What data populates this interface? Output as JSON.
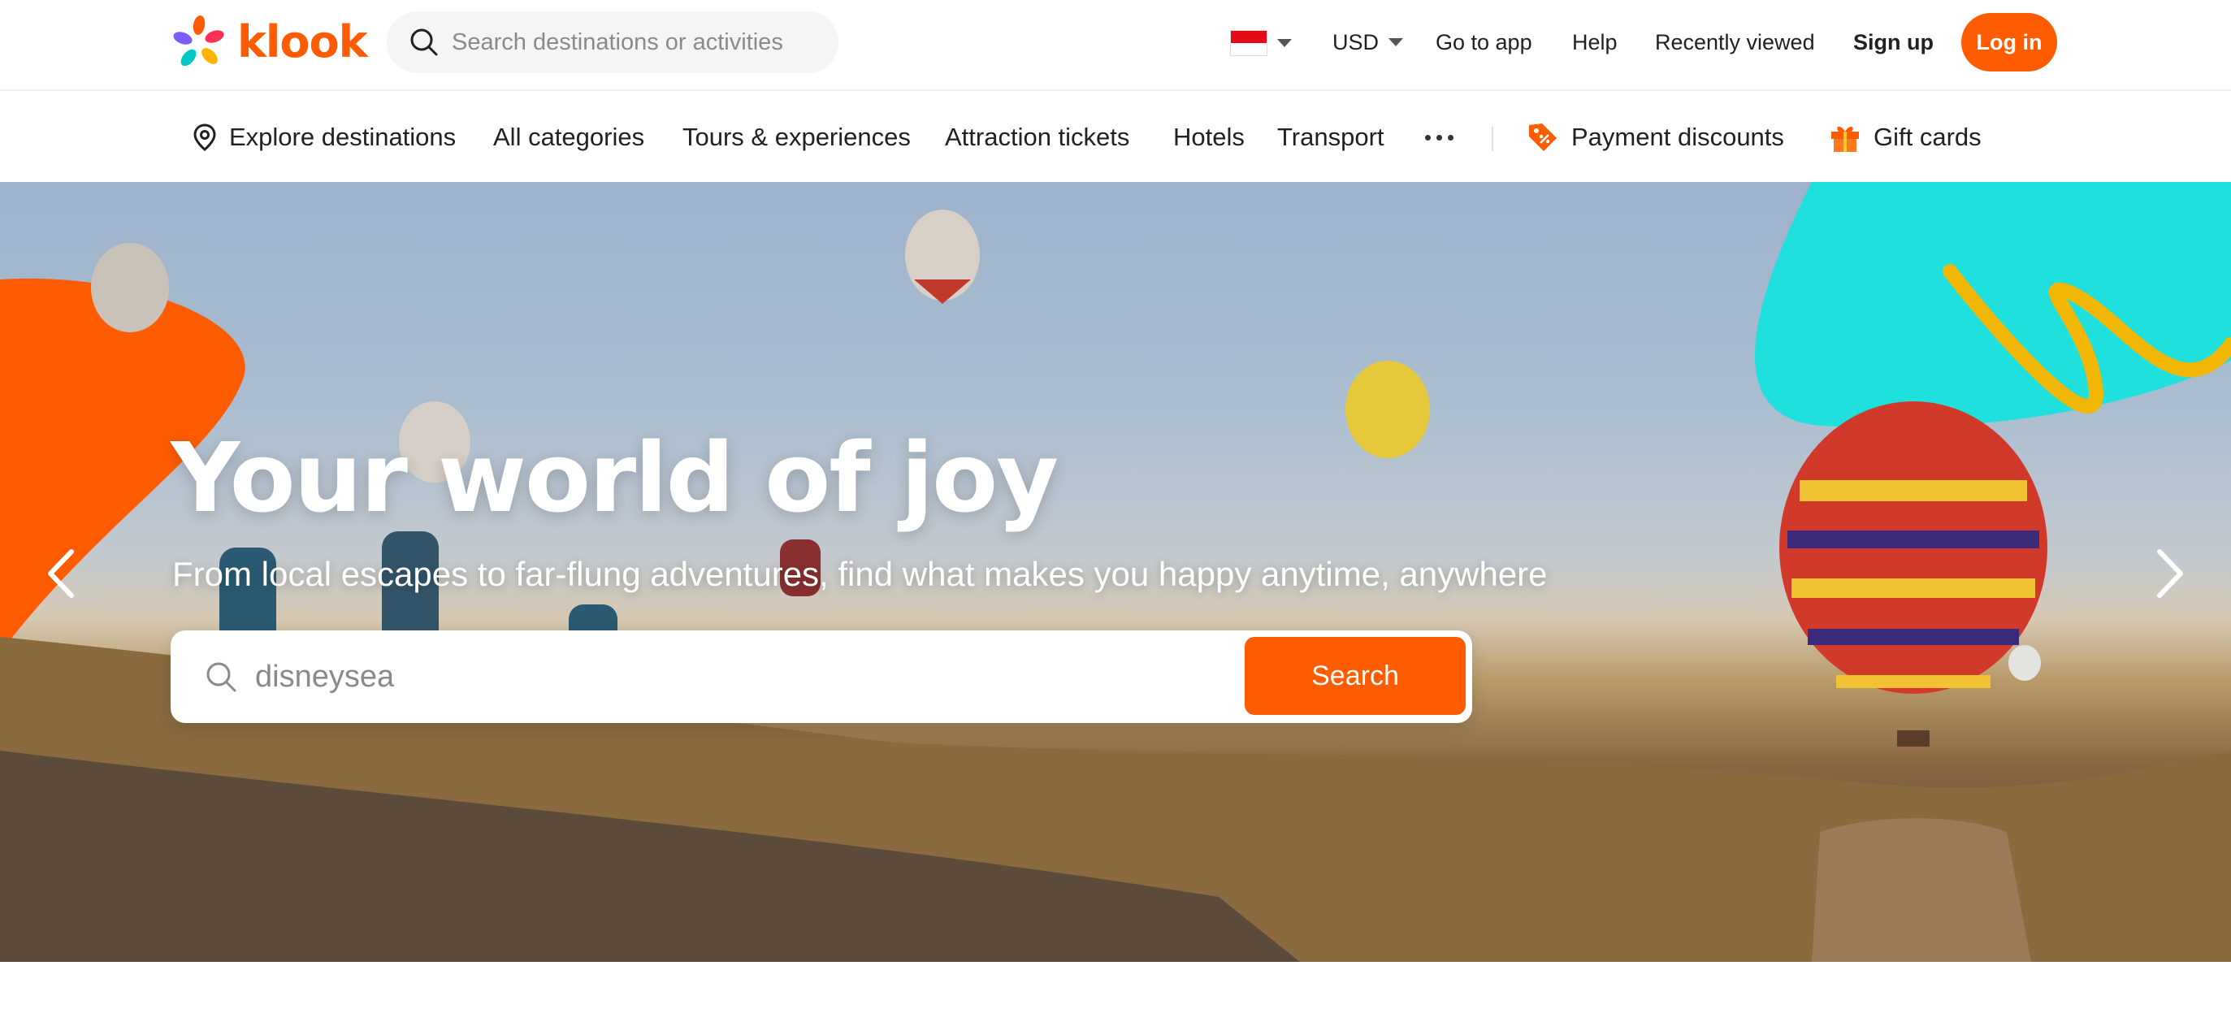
{
  "header": {
    "brand": "klook",
    "search_placeholder": "Search destinations or activities",
    "country_flag": "singapore-flag",
    "currency": "USD",
    "go_to_app": "Go to app",
    "help": "Help",
    "recently_viewed": "Recently viewed",
    "sign_up": "Sign up",
    "log_in": "Log in"
  },
  "categories": {
    "explore": "Explore destinations",
    "all": "All categories",
    "tours": "Tours & experiences",
    "attractions": "Attraction tickets",
    "hotels": "Hotels",
    "transport": "Transport",
    "payment_discounts": "Payment discounts",
    "gift_cards": "Gift cards"
  },
  "hero": {
    "title": "Your world of joy",
    "subtitle": "From local escapes to far-flung adventures, find what makes you happy anytime, anywhere",
    "search_value": "disneysea",
    "search_button": "Search"
  },
  "colors": {
    "brand_orange": "#ff5b00",
    "accent_cyan": "#1fe0dc",
    "accent_yellow": "#f2b705",
    "text": "#212121"
  }
}
